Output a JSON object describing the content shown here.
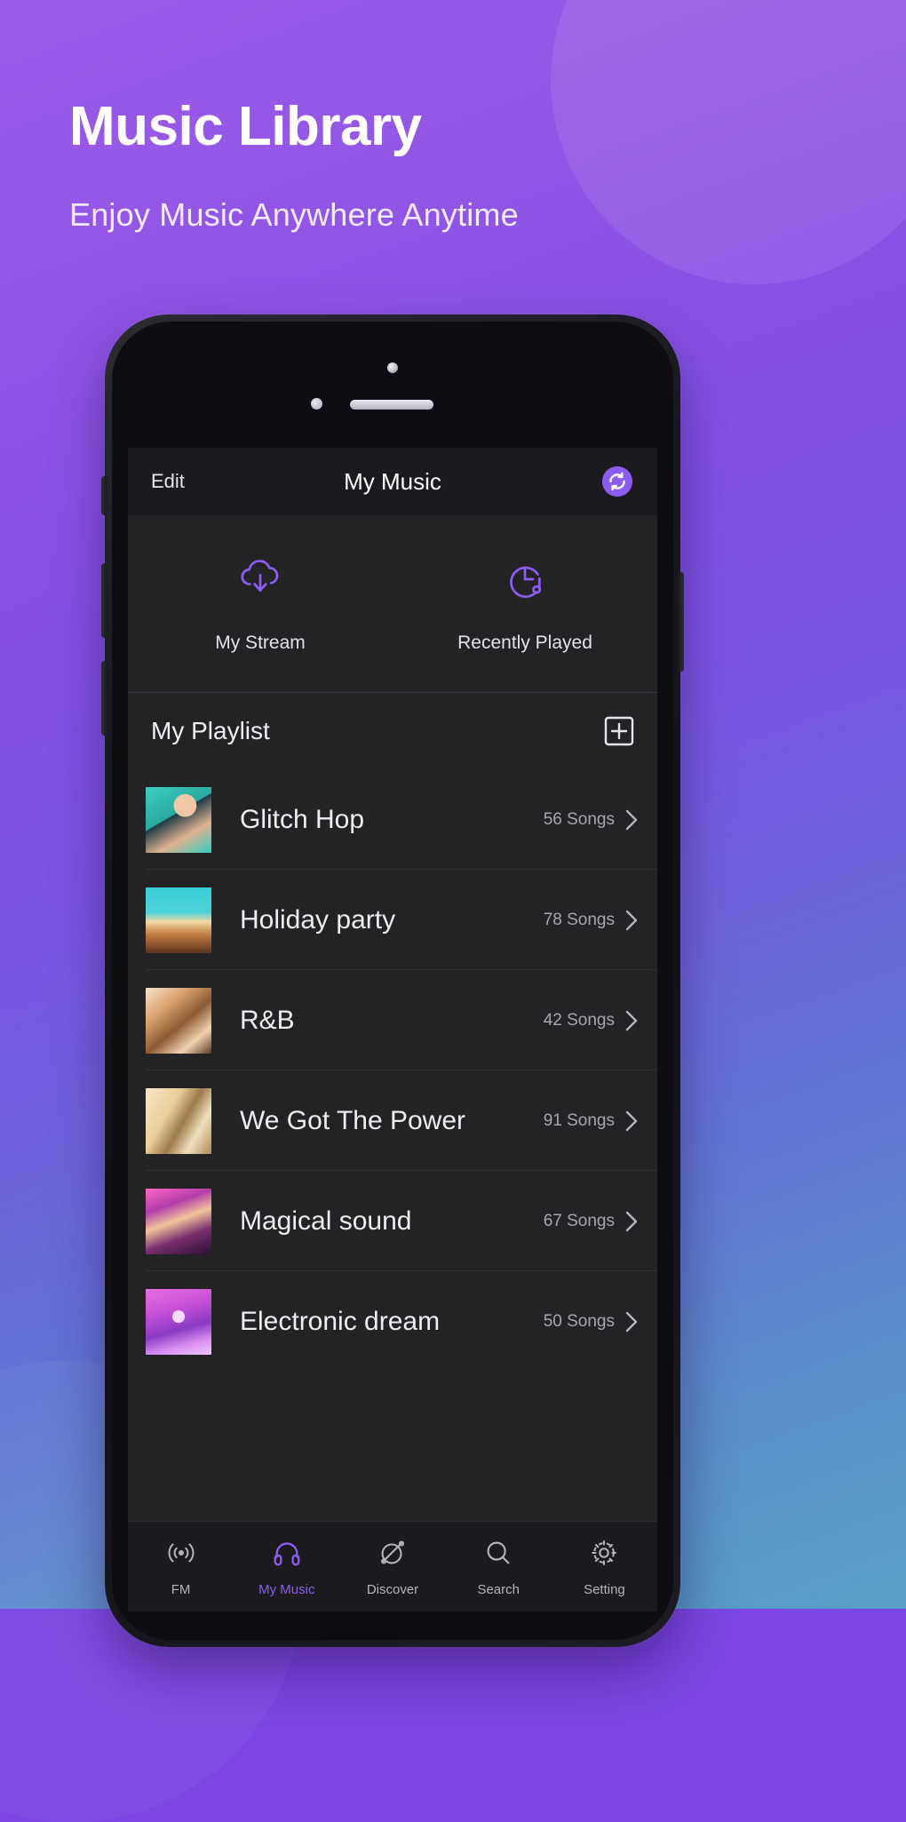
{
  "hero": {
    "title": "Music Library",
    "subtitle": "Enjoy Music Anywhere Anytime"
  },
  "colors": {
    "accent": "#8d5cf0",
    "screen_bg": "#232326",
    "navbar_bg": "#1b1b1f",
    "text_primary": "#eeeef1",
    "text_secondary": "#a6a6ad",
    "bg_gradient_start": "#9d5ae8",
    "bg_gradient_end": "#57a0c6"
  },
  "app": {
    "navbar": {
      "left_action": "Edit",
      "title": "My Music",
      "right_icon": "sync-icon"
    },
    "quick_actions": [
      {
        "label": "My Stream",
        "icon": "cloud-download-icon"
      },
      {
        "label": "Recently Played",
        "icon": "clock-music-icon"
      }
    ],
    "playlist_section": {
      "title": "My Playlist",
      "add_icon": "plus-square-icon",
      "items": [
        {
          "name": "Glitch Hop",
          "count": "56 Songs",
          "art": "art0"
        },
        {
          "name": "Holiday party",
          "count": "78 Songs",
          "art": "art1"
        },
        {
          "name": "R&B",
          "count": "42 Songs",
          "art": "art2"
        },
        {
          "name": "We Got The Power",
          "count": "91 Songs",
          "art": "art3"
        },
        {
          "name": "Magical sound",
          "count": "67 Songs",
          "art": "art4"
        },
        {
          "name": "Electronic dream",
          "count": "50 Songs",
          "art": "art5"
        }
      ]
    },
    "tabbar": {
      "active_index": 1,
      "items": [
        {
          "label": "FM",
          "icon": "radio-waves-icon"
        },
        {
          "label": "My Music",
          "icon": "headphones-icon"
        },
        {
          "label": "Discover",
          "icon": "planet-icon"
        },
        {
          "label": "Search",
          "icon": "magnifier-icon"
        },
        {
          "label": "Setting",
          "icon": "gear-icon"
        }
      ]
    }
  }
}
